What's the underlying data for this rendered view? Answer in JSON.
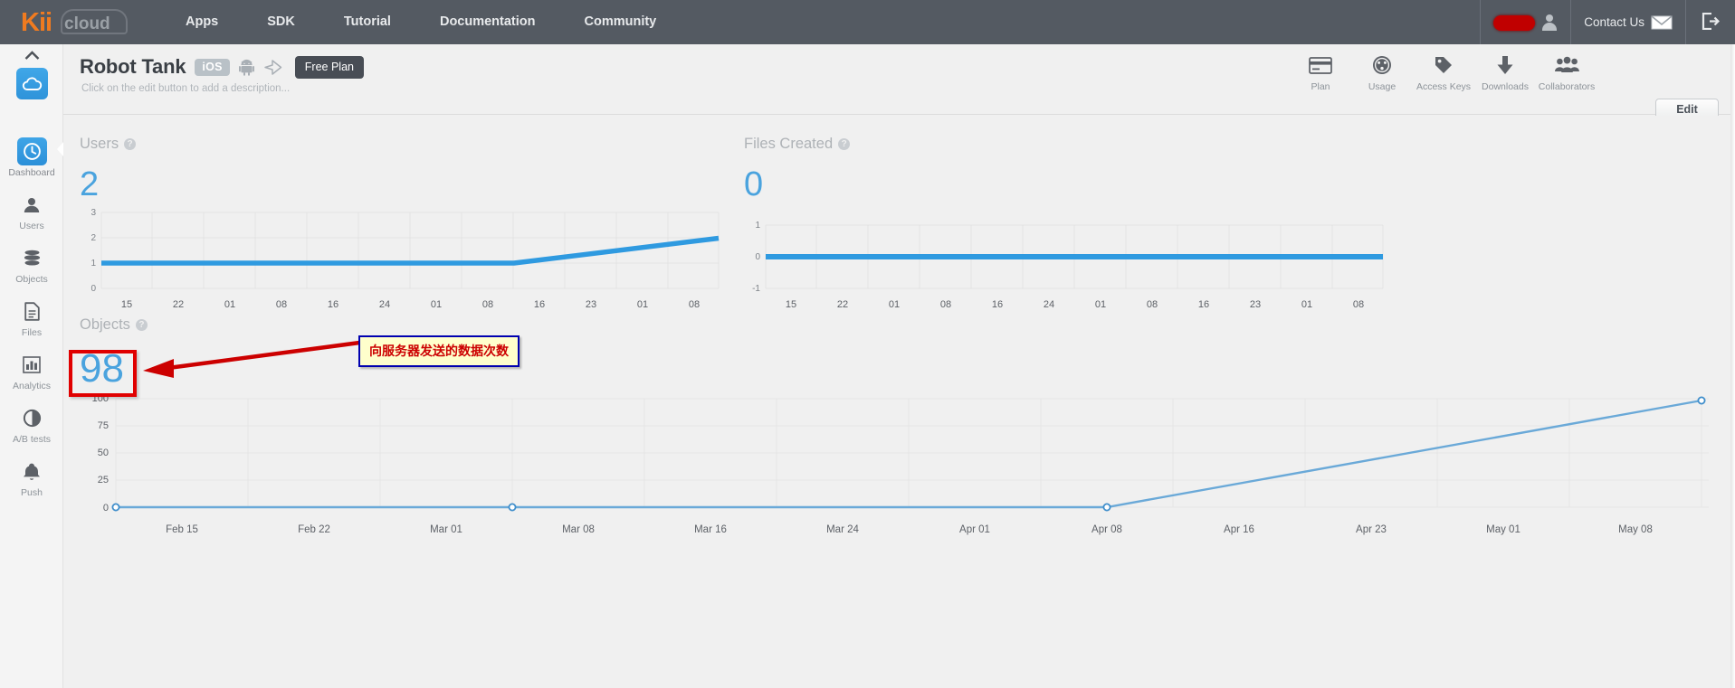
{
  "topnav": {
    "brand": {
      "kii": "Kii",
      "cloud": "cloud"
    },
    "links": [
      {
        "label": "Apps"
      },
      {
        "label": "SDK"
      },
      {
        "label": "Tutorial"
      },
      {
        "label": "Documentation"
      },
      {
        "label": "Community"
      }
    ],
    "account": {
      "name_redacted": "",
      "user_icon": "user-icon"
    },
    "contact": {
      "label": "Contact Us",
      "icon": "mail-icon"
    },
    "logout": {
      "icon": "logout-icon"
    }
  },
  "appheader": {
    "title": "Robot Tank",
    "platform_badge": "iOS",
    "platform_icons": [
      "android-icon",
      "unity-icon"
    ],
    "plan_badge": "Free Plan",
    "subtitle": "Click on the edit button to add a description...",
    "edit_label": "Edit",
    "tools": [
      {
        "label": "Plan",
        "icon": "credit-card-icon"
      },
      {
        "label": "Usage",
        "icon": "gauge-icon"
      },
      {
        "label": "Access Keys",
        "icon": "tag-icon"
      },
      {
        "label": "Downloads",
        "icon": "download-arrow-icon"
      },
      {
        "label": "Collaborators",
        "icon": "people-icon"
      }
    ]
  },
  "sidebar": {
    "collapse_icon": "chevron-up-icon",
    "app_icon": "cloud-icon",
    "items": [
      {
        "label": "Dashboard",
        "icon": "clock-icon",
        "active": true
      },
      {
        "label": "Users",
        "icon": "person-icon",
        "active": false
      },
      {
        "label": "Objects",
        "icon": "database-icon",
        "active": false
      },
      {
        "label": "Files",
        "icon": "document-icon",
        "active": false
      },
      {
        "label": "Analytics",
        "icon": "bar-chart-icon",
        "active": false
      },
      {
        "label": "A/B tests",
        "icon": "contrast-circle-icon",
        "active": false
      },
      {
        "label": "Push",
        "icon": "bell-icon",
        "active": false
      }
    ]
  },
  "annotation": {
    "callout_text": "向服务器发送的数据次数",
    "callout_border_color": "#0000b0",
    "callout_bg_color": "#ffffcc",
    "callout_text_color": "#cc0000",
    "highlight_color": "#e00000",
    "arrow_color": "#cc0000"
  },
  "chart_data": [
    {
      "id": "users",
      "type": "line",
      "title": "Users",
      "help_icon": "question-mark-icon",
      "big_value": "2",
      "xlabel": "",
      "ylabel": "",
      "ylim": [
        0,
        3
      ],
      "yticks": [
        "3",
        "2",
        "1",
        "0"
      ],
      "ytick_values": [
        3,
        2,
        1,
        0
      ],
      "categories": [
        "15",
        "22",
        "01",
        "08",
        "16",
        "24",
        "01",
        "08",
        "16",
        "23",
        "01",
        "08"
      ],
      "x": [
        0,
        1,
        2,
        3,
        4,
        5,
        6,
        7,
        8,
        9,
        10,
        11
      ],
      "values": [
        1,
        1,
        1,
        1,
        1,
        1,
        1,
        1,
        1.2,
        1.5,
        1.75,
        2
      ],
      "series": [
        {
          "name": "Users",
          "values": [
            1,
            1,
            1,
            1,
            1,
            1,
            1,
            1,
            1.2,
            1.5,
            1.75,
            2
          ],
          "color": "#2f9ae0"
        }
      ],
      "line_color": "#2f9ae0",
      "grid": true,
      "legend": "none"
    },
    {
      "id": "files_created",
      "type": "line",
      "title": "Files Created",
      "help_icon": "question-mark-icon",
      "big_value": "0",
      "xlabel": "",
      "ylabel": "",
      "ylim": [
        -1,
        1
      ],
      "yticks": [
        "1",
        "0",
        "-1"
      ],
      "ytick_values": [
        1,
        0,
        -1
      ],
      "categories": [
        "15",
        "22",
        "01",
        "08",
        "16",
        "24",
        "01",
        "08",
        "16",
        "23",
        "01",
        "08"
      ],
      "x": [
        0,
        1,
        2,
        3,
        4,
        5,
        6,
        7,
        8,
        9,
        10,
        11
      ],
      "values": [
        0,
        0,
        0,
        0,
        0,
        0,
        0,
        0,
        0,
        0,
        0,
        0
      ],
      "series": [
        {
          "name": "Files Created",
          "values": [
            0,
            0,
            0,
            0,
            0,
            0,
            0,
            0,
            0,
            0,
            0,
            0
          ],
          "color": "#2f9ae0"
        }
      ],
      "line_color": "#2f9ae0",
      "grid": true,
      "legend": "none"
    },
    {
      "id": "objects",
      "type": "line",
      "title": "Objects",
      "help_icon": "question-mark-icon",
      "big_value": "98",
      "xlabel": "",
      "ylabel": "",
      "ylim": [
        0,
        100
      ],
      "yticks": [
        "100",
        "75",
        "50",
        "25",
        "0"
      ],
      "ytick_values": [
        100,
        75,
        50,
        25,
        0
      ],
      "categories": [
        "Feb 15",
        "Feb 22",
        "Mar 01",
        "Mar 08",
        "Mar 16",
        "Mar 24",
        "Apr 01",
        "Apr 08",
        "Apr 16",
        "Apr 23",
        "May 01",
        "May 08"
      ],
      "x": [
        0,
        1,
        2,
        3,
        4,
        5,
        6,
        7,
        8,
        9,
        10,
        11
      ],
      "values": [
        0,
        0,
        0,
        0,
        0,
        0,
        0,
        0,
        24,
        48,
        73,
        98
      ],
      "markers": [
        {
          "x": 0,
          "y": 0
        },
        {
          "x": 3.1,
          "y": 0
        },
        {
          "x": 7.4,
          "y": 0
        },
        {
          "x": 11.2,
          "y": 98
        }
      ],
      "series": [
        {
          "name": "Objects",
          "values": [
            0,
            0,
            0,
            0,
            0,
            0,
            0,
            0,
            24,
            48,
            73,
            98
          ],
          "color": "#6aa9d8"
        }
      ],
      "line_color": "#6aa9d8",
      "grid": true,
      "legend": "none"
    }
  ]
}
